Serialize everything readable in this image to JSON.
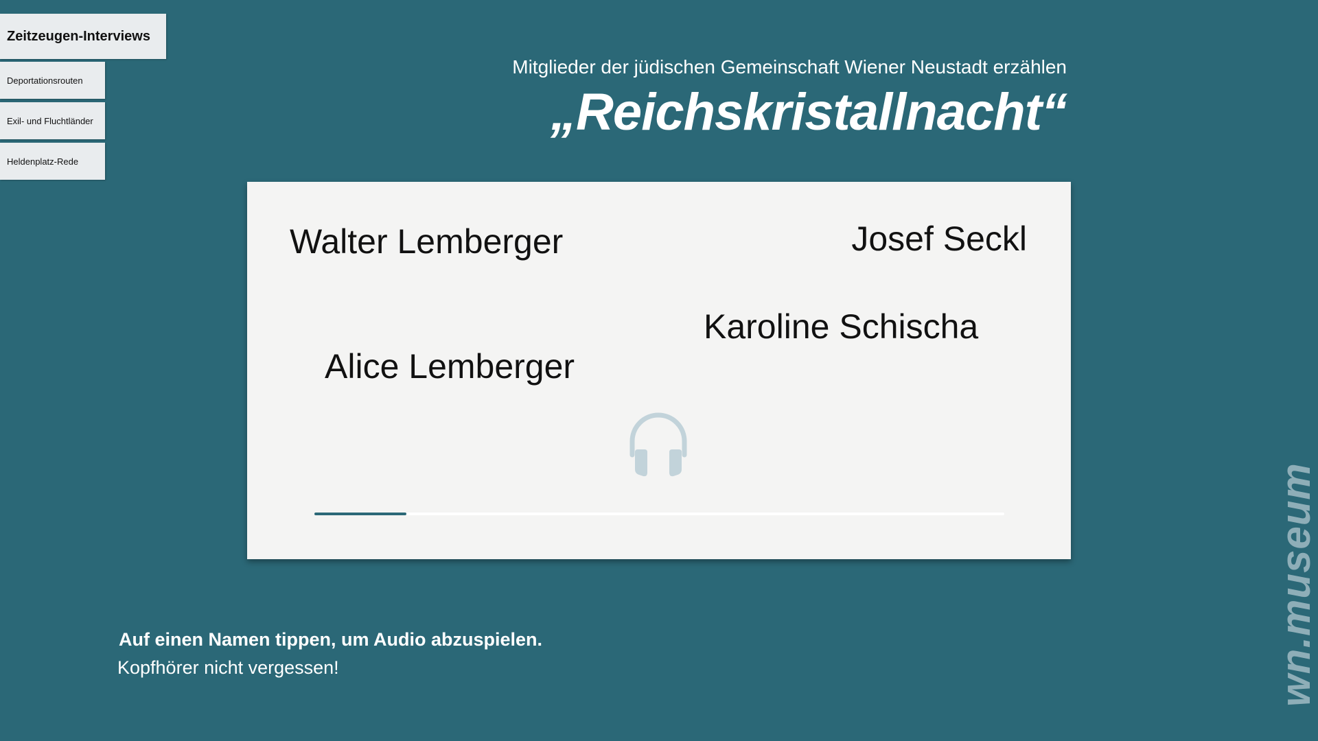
{
  "nav": {
    "active": "Zeitzeugen-Interviews",
    "items": [
      "Deportationsrouten",
      "Exil- und Fluchtländer",
      "Heldenplatz-Rede"
    ]
  },
  "header": {
    "subtitle": "Mitglieder der jüdischen Gemeinschaft Wiener Neustadt erzählen",
    "title": "„Reichskristallnacht“"
  },
  "card": {
    "names": [
      "Walter Lemberger",
      "Josef Seckl",
      "Karoline Schischa",
      "Alice Lemberger"
    ],
    "icon": "headphones-icon",
    "progress": 0.133
  },
  "instructions": {
    "line1": "Auf einen Namen tippen, um Audio abzuspielen.",
    "line2": "Kopfhörer nicht vergessen!"
  },
  "logo": "wn.museum",
  "colors": {
    "background": "#2b6877",
    "card": "#f4f4f3",
    "accent": "#2b6877",
    "icon": "#c2d3da",
    "logo": "#8eaeb8"
  }
}
